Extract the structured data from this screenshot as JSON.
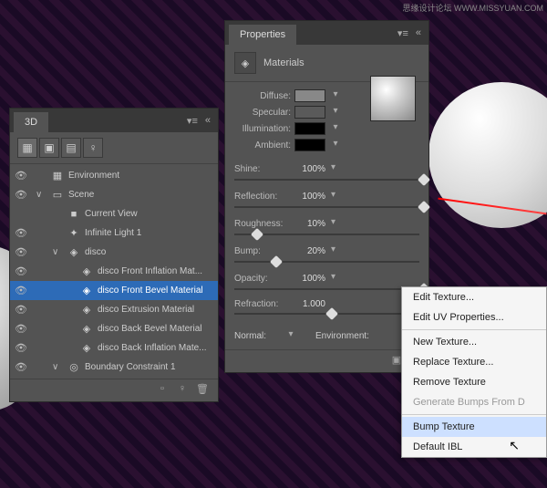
{
  "watermark": "思缘设计论坛 WWW.MISSYUAN.COM",
  "panel3d": {
    "title": "3D",
    "items": [
      {
        "label": "Environment",
        "icon": "▦",
        "indent": 0,
        "eye": true,
        "toggle": ""
      },
      {
        "label": "Scene",
        "icon": "▭",
        "indent": 0,
        "eye": true,
        "toggle": "∨"
      },
      {
        "label": "Current View",
        "icon": "■",
        "indent": 1,
        "eye": false,
        "toggle": ""
      },
      {
        "label": "Infinite Light 1",
        "icon": "✦",
        "indent": 1,
        "eye": true,
        "toggle": ""
      },
      {
        "label": "disco",
        "icon": "◈",
        "indent": 1,
        "eye": true,
        "toggle": "∨"
      },
      {
        "label": "disco Front Inflation Mat...",
        "icon": "◈",
        "indent": 2,
        "eye": true,
        "toggle": ""
      },
      {
        "label": "disco Front Bevel Material",
        "icon": "◈",
        "indent": 2,
        "eye": true,
        "toggle": "",
        "selected": true
      },
      {
        "label": "disco Extrusion Material",
        "icon": "◈",
        "indent": 2,
        "eye": true,
        "toggle": ""
      },
      {
        "label": "disco Back Bevel Material",
        "icon": "◈",
        "indent": 2,
        "eye": true,
        "toggle": ""
      },
      {
        "label": "disco Back Inflation Mate...",
        "icon": "◈",
        "indent": 2,
        "eye": true,
        "toggle": ""
      },
      {
        "label": "Boundary Constraint 1",
        "icon": "◎",
        "indent": 1,
        "eye": true,
        "toggle": "∨"
      }
    ]
  },
  "properties": {
    "title": "Properties",
    "subtitle": "Materials",
    "colors": [
      {
        "label": "Diffuse:",
        "hex": "#888888"
      },
      {
        "label": "Specular:",
        "hex": "#5a5a5a"
      },
      {
        "label": "Illumination:",
        "hex": "#000000"
      },
      {
        "label": "Ambient:",
        "hex": "#000000"
      }
    ],
    "sliders": [
      {
        "label": "Shine:",
        "value": "100%",
        "pos": 100,
        "icon": true
      },
      {
        "label": "Reflection:",
        "value": "100%",
        "pos": 100,
        "icon": true
      },
      {
        "label": "Roughness:",
        "value": "10%",
        "pos": 10,
        "icon": true
      },
      {
        "label": "Bump:",
        "value": "20%",
        "pos": 20,
        "icon": true
      },
      {
        "label": "Opacity:",
        "value": "100%",
        "pos": 100,
        "icon": true
      },
      {
        "label": "Refraction:",
        "value": "1.000",
        "pos": 50,
        "icon": false
      }
    ],
    "normal_label": "Normal:",
    "environment_label": "Environment:"
  },
  "context_menu": {
    "items": [
      {
        "label": "Edit Texture...",
        "type": "item"
      },
      {
        "label": "Edit UV Properties...",
        "type": "item"
      },
      {
        "type": "sep"
      },
      {
        "label": "New Texture...",
        "type": "item"
      },
      {
        "label": "Replace Texture...",
        "type": "item"
      },
      {
        "label": "Remove Texture",
        "type": "item"
      },
      {
        "label": "Generate Bumps From D",
        "type": "disabled"
      },
      {
        "type": "sep"
      },
      {
        "label": "Bump Texture",
        "type": "highlighted"
      },
      {
        "label": "Default IBL",
        "type": "item"
      }
    ]
  }
}
